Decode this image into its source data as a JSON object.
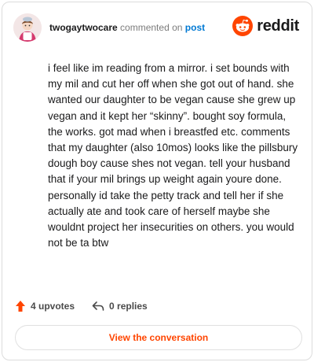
{
  "header": {
    "username": "twogaytwocare",
    "verb": "commented on",
    "post_link": "post",
    "logo_word": "reddit"
  },
  "comment": {
    "text": "i feel like im reading from a mirror. i set bounds with my mil and cut her off when she got out of hand. she wanted our daughter to be vegan cause she grew up vegan and it kept her “skinny”. bought soy formula, the works. got mad when i breastfed etc. comments that my daughter (also 10mos) looks like the pillsbury dough boy cause shes not vegan. tell your husband that if your mil brings up weight again youre done. personally id take the petty track and tell her if she actually ate and took care of herself maybe she wouldnt project her insecurities on others. you would not be ta btw"
  },
  "stats": {
    "upvotes": "4 upvotes",
    "replies": "0 replies"
  },
  "cta": {
    "label": "View the conversation"
  },
  "colors": {
    "accent": "#ff4500",
    "link": "#0079d3",
    "border": "#dcdcdc"
  }
}
